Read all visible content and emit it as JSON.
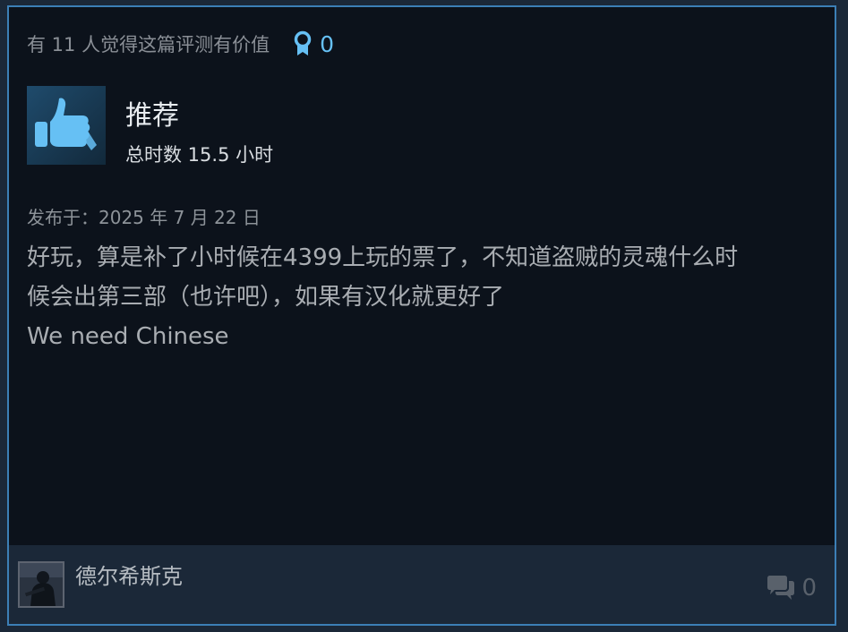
{
  "helpful": {
    "text": "有 11 人觉得这篇评测有价值",
    "award_count": "0"
  },
  "review": {
    "verdict": "推荐",
    "hours": "总时数 15.5 小时",
    "posted": "发布于：2025 年 7 月 22 日",
    "body_lines": [
      "好玩，算是补了小时候在4399上玩的票了，不知道盗贼的灵魂什么时",
      "候会出第三部（也许吧），如果有汉化就更好了",
      "We need Chinese"
    ]
  },
  "author": {
    "name": "德尔希斯克"
  },
  "comments": {
    "count": "0"
  },
  "colors": {
    "accent": "#66c0f4",
    "border": "#3c7fb6",
    "card_bg": "#0c121b",
    "footer_bg": "#1b2838"
  },
  "icons": {
    "award": "award-ribbon-icon",
    "thumb": "thumbs-up-icon",
    "comment": "comment-bubbles-icon"
  }
}
